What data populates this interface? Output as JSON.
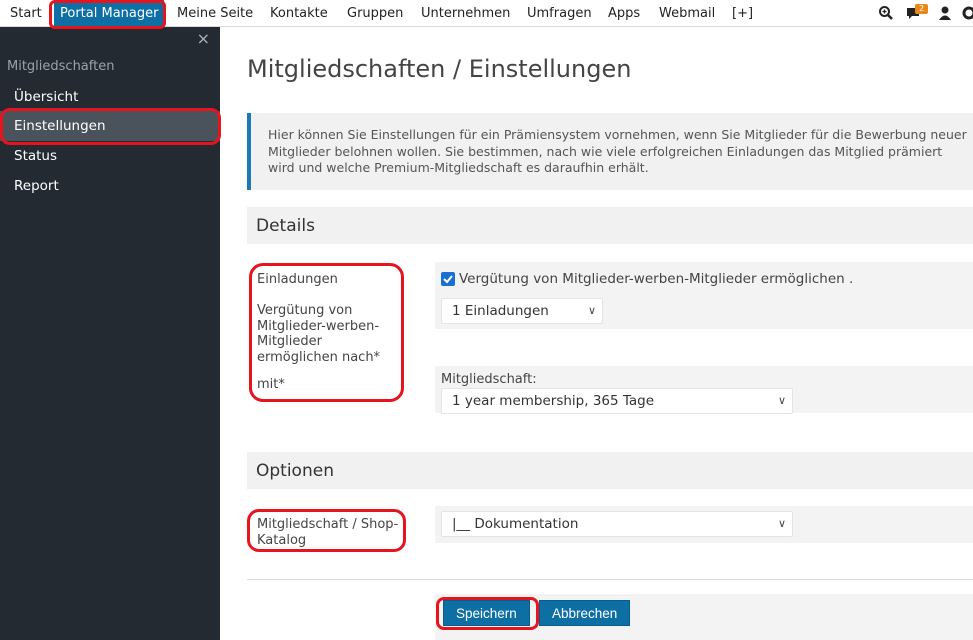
{
  "nav": {
    "start": "Start",
    "portal_manager": "Portal Manager",
    "meine_seite": "Meine Seite",
    "kontakte": "Kontakte",
    "gruppen": "Gruppen",
    "unternehmen": "Unternehmen",
    "umfragen": "Umfragen",
    "apps": "Apps",
    "webmail": "Webmail",
    "plus": "[+]",
    "chat_badge": "2"
  },
  "sidebar": {
    "close": "×",
    "section": "Mitgliedschaften",
    "items": [
      {
        "label": "Übersicht"
      },
      {
        "label": "Einstellungen"
      },
      {
        "label": "Status"
      },
      {
        "label": "Report"
      }
    ]
  },
  "page": {
    "title": "Mitgliedschaften / Einstellungen",
    "info": "Hier können Sie Einstellungen für ein Prämiensystem vornehmen, wenn Sie Mitglieder für die Bewerbung neuer Mitglieder belohnen wollen. Sie bestimmen, nach wie viele erfolgreichen Einladungen das Mitglied prämiert wird und welche Premium-Mitgliedschaft es daraufhin erhält."
  },
  "details": {
    "heading": "Details",
    "label_einladungen": "Einladungen",
    "label_verguetung": "Vergütung von Mitglieder-werben-Mitglieder ermöglichen nach*",
    "label_mit": "mit*",
    "checkbox_label": "Vergütung von Mitglieder-werben-Mitglieder ermöglichen .",
    "checkbox_checked": true,
    "einladungen_select": "1 Einladungen",
    "mitgliedschaft_caption": "Mitgliedschaft:",
    "mitgliedschaft_select": "1 year membership, 365 Tage"
  },
  "optionen": {
    "heading": "Optionen",
    "label_katalog": "Mitgliedschaft / Shop-Katalog",
    "katalog_select": "|__ Dokumentation"
  },
  "buttons": {
    "save": "Speichern",
    "cancel": "Abbrechen"
  },
  "colors": {
    "accent": "#0e6fa5",
    "sidebar_bg": "#232a31",
    "highlight": "#e8141d",
    "badge": "#e8871a"
  }
}
